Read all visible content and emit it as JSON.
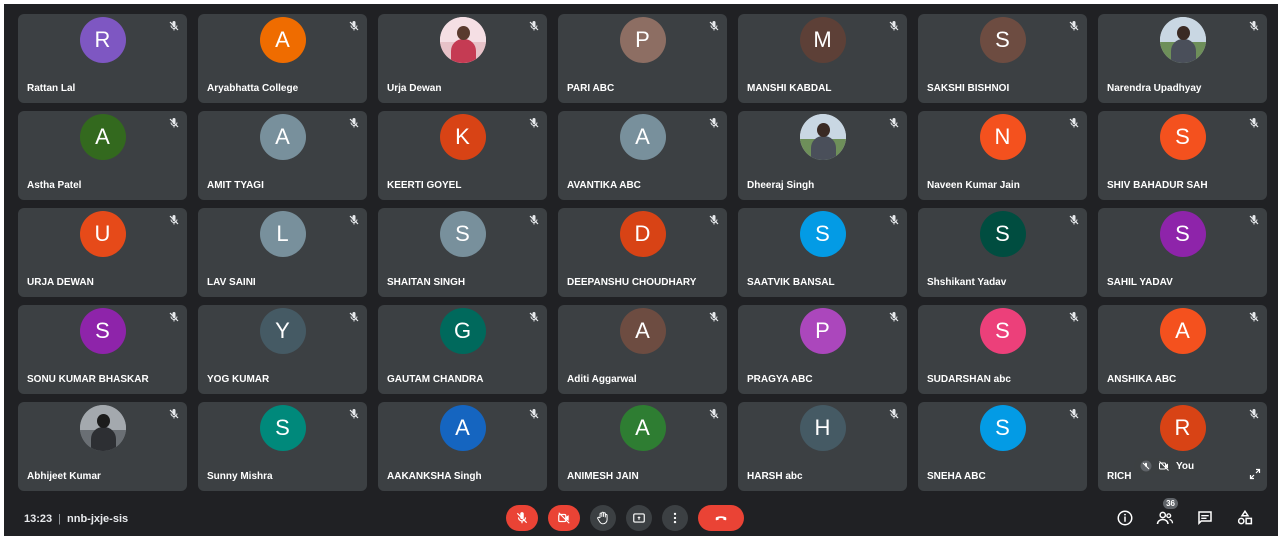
{
  "meeting": {
    "time": "13:23",
    "code": "nnb-jxje-sis"
  },
  "participants_count": "36",
  "self_overlay": {
    "label": "You"
  },
  "tiles": [
    {
      "name": "Rattan Lal",
      "initial": "R",
      "color": "#7e57c2"
    },
    {
      "name": "Aryabhatta College",
      "initial": "A",
      "color": "#ef6c00"
    },
    {
      "name": "Urja Dewan",
      "initial": "",
      "photo": "light"
    },
    {
      "name": "PARI ABC",
      "initial": "P",
      "color": "#8d6e63"
    },
    {
      "name": "MANSHI KABDAL",
      "initial": "M",
      "color": "#5d4037"
    },
    {
      "name": "SAKSHI BISHNOI",
      "initial": "S",
      "color": "#6d4c41"
    },
    {
      "name": "Narendra Upadhyay",
      "initial": "",
      "photo": "normal"
    },
    {
      "name": "Astha Patel",
      "initial": "A",
      "color": "#33691e"
    },
    {
      "name": "AMIT TYAGI",
      "initial": "A",
      "color": "#78909c"
    },
    {
      "name": "KEERTI GOYEL",
      "initial": "K",
      "color": "#d84315"
    },
    {
      "name": "AVANTIKA ABC",
      "initial": "A",
      "color": "#78909c"
    },
    {
      "name": "Dheeraj Singh",
      "initial": "",
      "photo": "normal"
    },
    {
      "name": "Naveen Kumar Jain",
      "initial": "N",
      "color": "#f4511e"
    },
    {
      "name": "SHIV BAHADUR SAH",
      "initial": "S",
      "color": "#f4511e"
    },
    {
      "name": "URJA DEWAN",
      "initial": "U",
      "color": "#e64a19"
    },
    {
      "name": "LAV SAINI",
      "initial": "L",
      "color": "#78909c"
    },
    {
      "name": "SHAITAN SINGH",
      "initial": "S",
      "color": "#78909c"
    },
    {
      "name": "DEEPANSHU CHOUDHARY",
      "initial": "D",
      "color": "#d84315"
    },
    {
      "name": "SAATVIK BANSAL",
      "initial": "S",
      "color": "#039be5"
    },
    {
      "name": "Shshikant Yadav",
      "initial": "S",
      "color": "#004d40"
    },
    {
      "name": "SAHIL YADAV",
      "initial": "S",
      "color": "#8e24aa"
    },
    {
      "name": "SONU KUMAR BHASKAR",
      "initial": "S",
      "color": "#8e24aa"
    },
    {
      "name": "YOG KUMAR",
      "initial": "Y",
      "color": "#455a64"
    },
    {
      "name": "GAUTAM CHANDRA",
      "initial": "G",
      "color": "#00695c"
    },
    {
      "name": "Aditi Aggarwal",
      "initial": "A",
      "color": "#6d4c41"
    },
    {
      "name": "PRAGYA ABC",
      "initial": "P",
      "color": "#ab47bc"
    },
    {
      "name": "SUDARSHAN abc",
      "initial": "S",
      "color": "#ec407a"
    },
    {
      "name": "ANSHIKA ABC",
      "initial": "A",
      "color": "#f4511e"
    },
    {
      "name": "Abhijeet Kumar",
      "initial": "",
      "photo": "dark"
    },
    {
      "name": "Sunny Mishra",
      "initial": "S",
      "color": "#00897b"
    },
    {
      "name": "AAKANKSHA Singh",
      "initial": "A",
      "color": "#1565c0"
    },
    {
      "name": "ANIMESH JAIN",
      "initial": "A",
      "color": "#2e7d32"
    },
    {
      "name": "HARSH abc",
      "initial": "H",
      "color": "#455a64"
    },
    {
      "name": "SNEHA ABC",
      "initial": "S",
      "color": "#039be5"
    },
    {
      "name": "RICH",
      "initial": "R",
      "color": "#d84315",
      "self": true
    }
  ],
  "icons": {
    "mic_off": "mic-off-icon",
    "cam_off": "camera-off-icon",
    "hand": "raise-hand-icon",
    "present": "present-screen-icon",
    "more": "more-options-icon",
    "leave": "leave-call-icon",
    "info": "info-icon",
    "people": "people-icon",
    "chat": "chat-icon",
    "activities": "activities-icon"
  }
}
